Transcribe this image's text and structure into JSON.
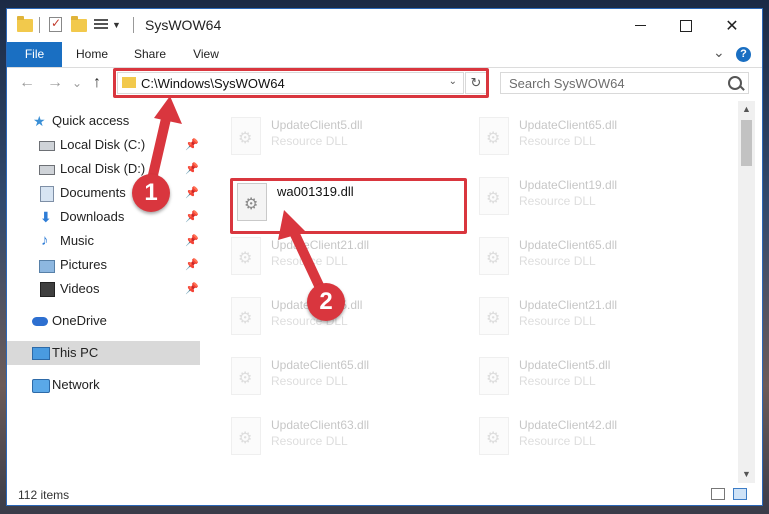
{
  "window": {
    "title": "SysWOW64",
    "controls": {
      "minimize": "—",
      "maximize": "☐",
      "close": "✕"
    }
  },
  "ribbon": {
    "tabs": [
      "File",
      "Home",
      "Share",
      "View"
    ],
    "collapse_glyph": "⌄",
    "help_glyph": "?"
  },
  "nav": {
    "back_glyph": "←",
    "forward_glyph": "→",
    "recent_glyph": "⌄",
    "up_glyph": "↑",
    "address": "C:\\Windows\\SysWOW64",
    "address_caret": "⌄",
    "refresh_glyph": "↻",
    "search_placeholder": "Search SysWOW64"
  },
  "sidebar": {
    "items": [
      {
        "label": "Quick access",
        "icon": "star-icon"
      },
      {
        "label": "Local Disk (C:)",
        "icon": "drive-icon",
        "pinned": true
      },
      {
        "label": "Local Disk (D:)",
        "icon": "drive-icon",
        "pinned": true
      },
      {
        "label": "Documents",
        "icon": "documents-icon",
        "pinned": true
      },
      {
        "label": "Downloads",
        "icon": "downloads-icon",
        "pinned": true
      },
      {
        "label": "Music",
        "icon": "music-icon",
        "pinned": true
      },
      {
        "label": "Pictures",
        "icon": "pictures-icon",
        "pinned": true
      },
      {
        "label": "Videos",
        "icon": "videos-icon",
        "pinned": true
      },
      {
        "label": "OneDrive",
        "icon": "onedrive-icon"
      },
      {
        "label": "This PC",
        "icon": "this-pc-icon",
        "selected": true
      },
      {
        "label": "Network",
        "icon": "network-icon"
      }
    ],
    "pin_glyph": "📌"
  },
  "files": {
    "type_label": "Resource DLL",
    "left_column": [
      "UpdateClient5.dll",
      "wa001319.dll",
      "UpdateClient21.dll",
      "UpdateClient5.dll",
      "UpdateClient65.dll",
      "UpdateClient63.dll"
    ],
    "right_column": [
      "UpdateClient65.dll",
      "UpdateClient19.dll",
      "UpdateClient65.dll",
      "UpdateClient21.dll",
      "UpdateClient5.dll",
      "UpdateClient42.dll"
    ],
    "highlighted": "wa001319.dll"
  },
  "status": {
    "item_count": "112 items"
  },
  "annotations": {
    "step1": "1",
    "step2": "2",
    "color": "#d9363e"
  }
}
